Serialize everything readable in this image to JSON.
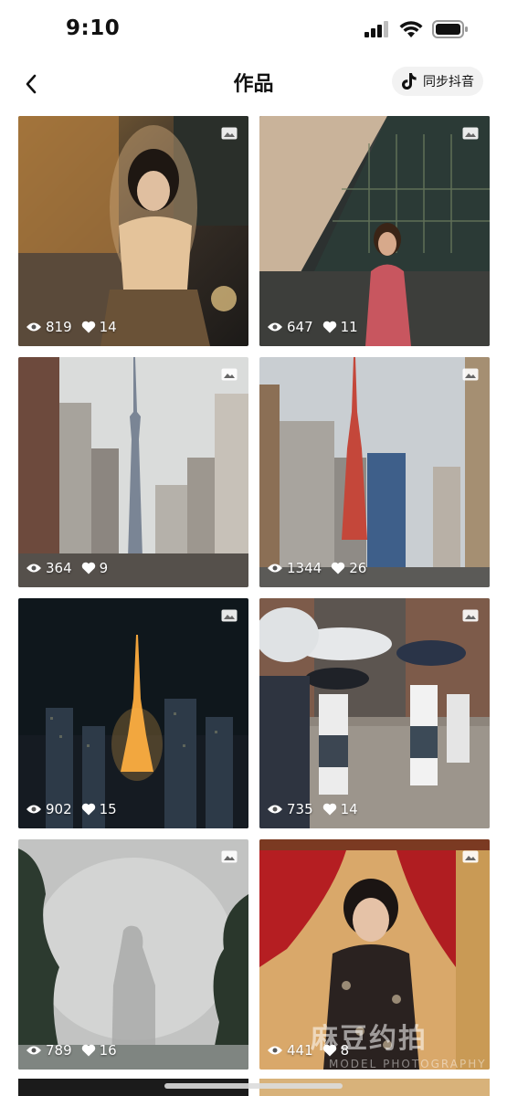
{
  "status_bar": {
    "time": "9:10"
  },
  "header": {
    "title": "作品",
    "sync_label": "同步抖音"
  },
  "works": [
    {
      "views": "819",
      "likes": "14",
      "scene": "girl-alley-night"
    },
    {
      "views": "647",
      "likes": "11",
      "scene": "woman-red-dress-building"
    },
    {
      "views": "364",
      "likes": "9",
      "scene": "skytree-street"
    },
    {
      "views": "1344",
      "likes": "26",
      "scene": "tokyo-tower-day"
    },
    {
      "views": "902",
      "likes": "15",
      "scene": "tokyo-tower-night"
    },
    {
      "views": "735",
      "likes": "14",
      "scene": "umbrellas-rain"
    },
    {
      "views": "789",
      "likes": "16",
      "scene": "foggy-statue"
    },
    {
      "views": "441",
      "likes": "8",
      "scene": "kimono-girl-red-curtain"
    }
  ],
  "watermark": {
    "text": "麻豆约拍",
    "sub": "MODEL PHOTOGRAPHY"
  },
  "colors": {
    "overlay_text": "#ffffff",
    "sync_bg": "#f2f2f2"
  }
}
